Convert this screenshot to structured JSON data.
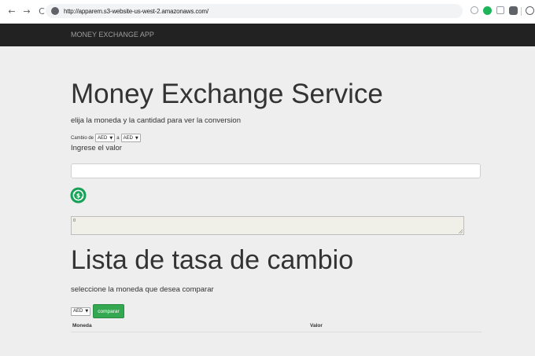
{
  "browser": {
    "url": "http://apparem.s3-website-us-west-2.amazonaws.com/",
    "back_icon": "arrow-left-icon",
    "forward_icon": "arrow-right-icon",
    "reload_icon": "reload-icon",
    "back_glyph": "←",
    "forward_glyph": "→",
    "reload_glyph": "C"
  },
  "navbar": {
    "brand": "MONEY EXCHANGE APP"
  },
  "exchange": {
    "title": "Money Exchange Service",
    "subtitle": "elija la moneda y la cantidad para ver la conversion",
    "from_label": "Cambio de",
    "from_value": "AED",
    "to_label": "a",
    "to_value": "AED",
    "amount_label": "Ingrese el valor",
    "amount_value": "",
    "result_value": "0",
    "convert_icon": "currency-convert-icon"
  },
  "rates": {
    "title": "Lista de tasa de cambio",
    "subtitle": "seleccione la moneda que desea comparar",
    "currency_value": "AED",
    "compare_label": "comparar",
    "columns": [
      "Moneda",
      "Valor"
    ]
  },
  "colors": {
    "navbar_bg": "#222222",
    "page_bg": "#eeeeee",
    "button_green": "#33a850",
    "convert_icon_green": "#1aa158"
  }
}
